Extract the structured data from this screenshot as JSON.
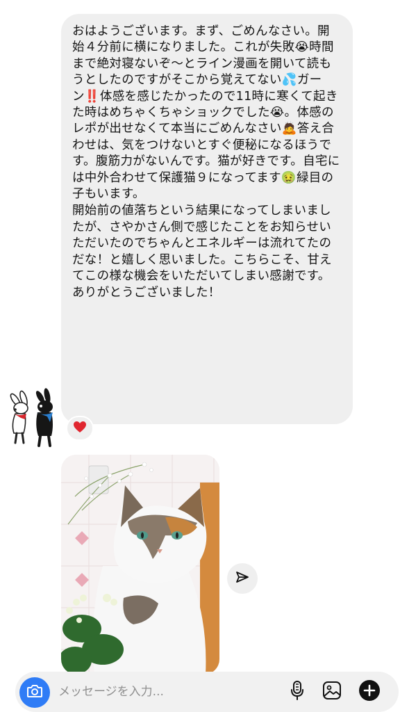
{
  "thread": {
    "message": {
      "paragraphs": [
        "おはようございます。まず、ごめんなさい。開始４分前に横になりました。これが失敗😭時間まで絶対寝ないぞ〜とライン漫画を開いて読もうとしたのですがそこから覚えてない💦ガーン‼️体感を感じたかったので11時に寒くて起きた時はめちゃくちゃショックでした😭。体感のレポが出せなくて本当にごめんなさい🙇答え合わせは、気をつけないとすぐ便秘になるほうです。腹筋力がないんです。猫が好きです。自宅には中外合わせて保護猫９になってます🤢緑目の子もいます。",
        "開始前の値落ちという結果になってしまいましたが、さやかさん側で感じたことをお知らせいただいたのでちゃんとエネルギーは流れてたのだな！と嬉しく思いました。こちらこそ、甘えてこの様な機会をいただいてしまい感謝です。ありがとうございました！"
      ],
      "reaction_icon": "red-heart-icon"
    },
    "avatar_icon": "cartoon-dogs-avatar",
    "photo": {
      "subject": "calico-cat-photo"
    },
    "share_icon": "paper-plane-icon"
  },
  "composer": {
    "placeholder": "メッセージを入力...",
    "camera_icon": "camera-icon",
    "mic_icon": "microphone-icon",
    "gallery_icon": "gallery-icon",
    "plus_icon": "plus-circle-icon",
    "accent": "#2f7cf6"
  }
}
